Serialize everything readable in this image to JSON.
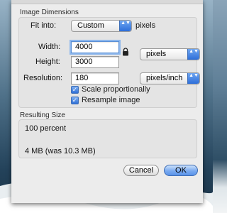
{
  "dimensions_group": {
    "title": "Image Dimensions",
    "fit_into_label": "Fit into:",
    "fit_into_value": "Custom",
    "fit_into_unit": "pixels",
    "width_label": "Width:",
    "width_value": "4000",
    "height_label": "Height:",
    "height_value": "3000",
    "size_unit_value": "pixels",
    "resolution_label": "Resolution:",
    "resolution_value": "180",
    "resolution_unit_value": "pixels/inch",
    "scale_proportionally_label": "Scale proportionally",
    "scale_proportionally_checked": true,
    "resample_label": "Resample image",
    "resample_checked": true,
    "check_mark": "✓"
  },
  "resulting_group": {
    "title": "Resulting Size",
    "percent_text": "100 percent",
    "size_text": "4 MB (was 10.3 MB)"
  },
  "buttons": {
    "cancel_label": "Cancel",
    "ok_label": "OK"
  },
  "icons": {
    "popup_arrows": "▲▼",
    "lock": "lock-icon"
  },
  "colors": {
    "accent_blue": "#2d6ed9",
    "sheet_bg": "#ececec"
  }
}
